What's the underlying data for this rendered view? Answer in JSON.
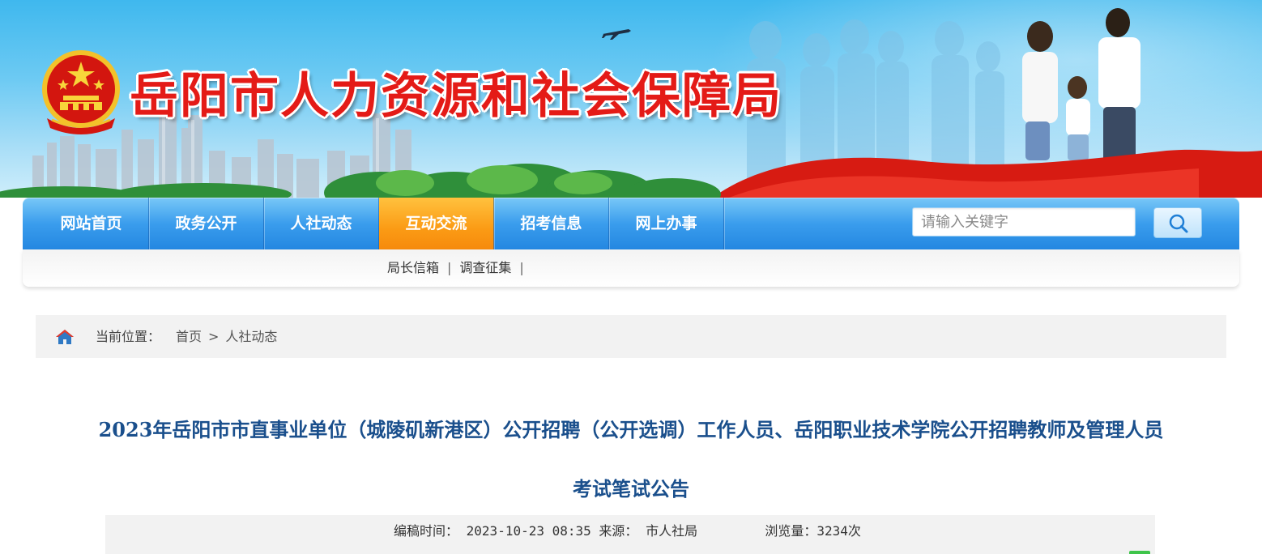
{
  "header": {
    "site_title": "岳阳市人力资源和社会保障局",
    "emblem_icon": "national-emblem",
    "title_color": "#e41b17"
  },
  "nav": {
    "items": [
      {
        "label": "网站首页"
      },
      {
        "label": "政务公开"
      },
      {
        "label": "人社动态"
      },
      {
        "label": "互动交流",
        "active": true
      },
      {
        "label": "招考信息"
      },
      {
        "label": "网上办事"
      }
    ],
    "active_color": "#f68a0c",
    "bar_color": "#2f93e8",
    "search": {
      "placeholder": "请输入关键字",
      "icon": "search-icon"
    }
  },
  "subnav": {
    "links": [
      {
        "label": "局长信箱"
      },
      {
        "label": "调查征集"
      }
    ],
    "separator": "|"
  },
  "breadcrumb": {
    "label": "当前位置：",
    "items": [
      "首页",
      "人社动态"
    ],
    "arrow": ">",
    "icon": "home-icon"
  },
  "article": {
    "title_line1": "2023年岳阳市市直事业单位（城陵矶新港区）公开招聘（公开选调）工作人员、岳阳职业技术学院公开招聘教师及管理人员",
    "title_line2": "考试笔试公告",
    "title_color": "#1a4f8c",
    "meta": {
      "date_label": "编稿时间：",
      "date": "2023-10-23 08:35",
      "source_label": "来源：",
      "source": "市人社局",
      "views_label": "浏览量：",
      "views": "3234次"
    }
  }
}
